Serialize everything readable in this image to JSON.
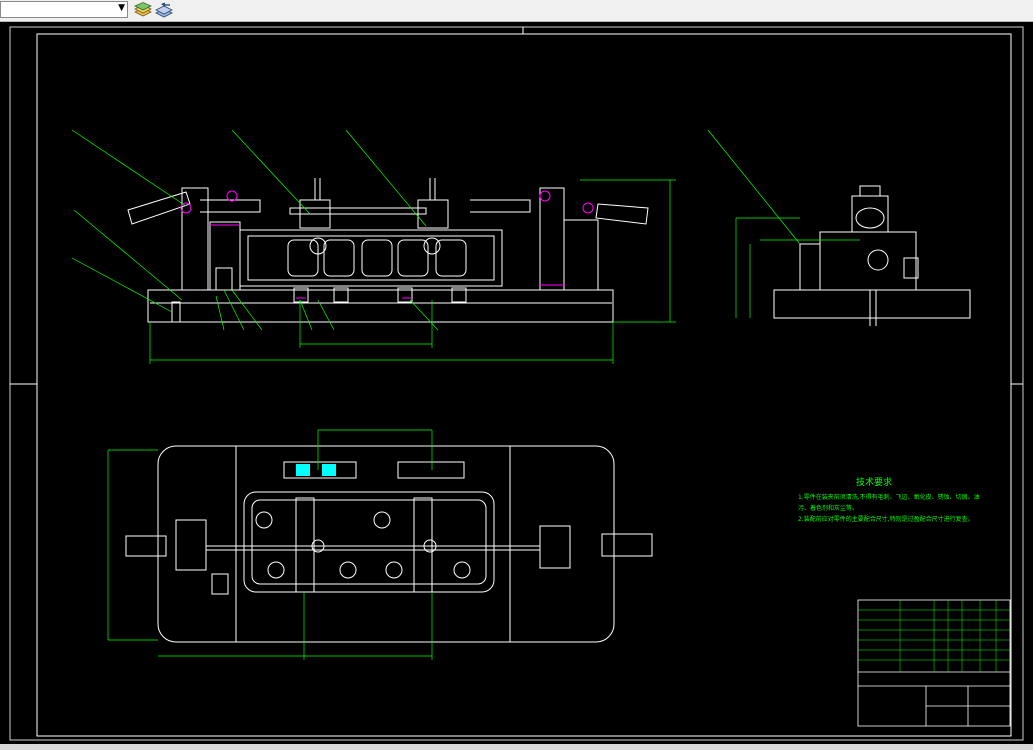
{
  "toolbar": {
    "layer_value": "",
    "layer_placeholder": "",
    "icons": [
      "layer-states-icon",
      "layer-previous-icon"
    ]
  },
  "drawing": {
    "tech_title": "技术要求",
    "tech_notes": [
      "1.零件在装夹前须清洗,不得有毛刺、飞边、氧化皮、锈蚀、切屑、油",
      "污、着色剂和灰尘等。",
      "2.装配前应对零件的主要配合尺寸,特别是过盈配合尺寸进行复查。"
    ],
    "colors": {
      "background": "#000000",
      "outline": "#ffffff",
      "dimension": "#00ff00",
      "highlight": "#00ffff",
      "hatch": "#ff00ff"
    }
  }
}
